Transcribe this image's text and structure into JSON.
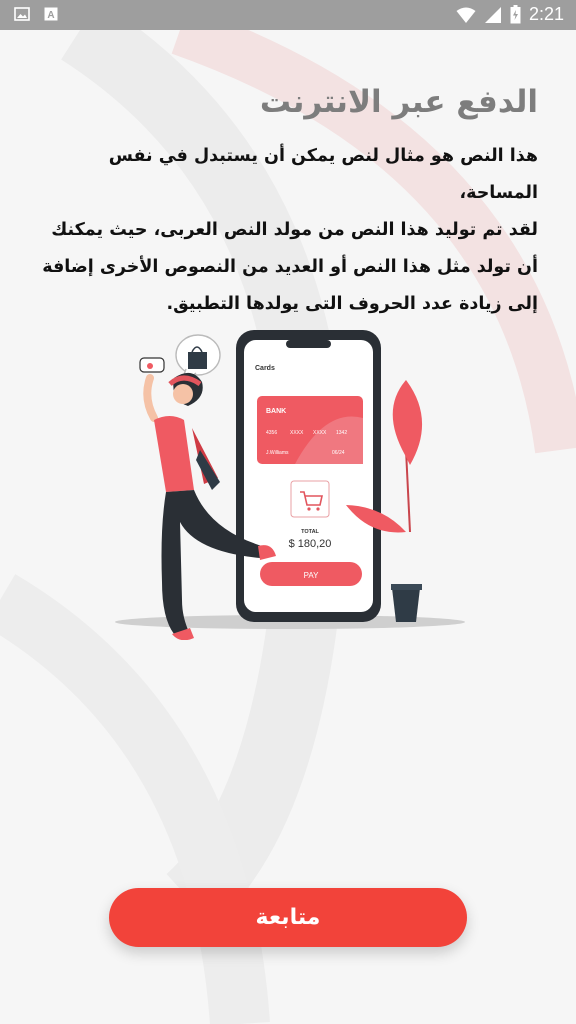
{
  "status_bar": {
    "time": "2:21",
    "left_icons": [
      "image-icon",
      "a-badge-icon"
    ],
    "right_icons": [
      "wifi-icon",
      "signal-icon",
      "battery-icon"
    ]
  },
  "onboarding": {
    "title": "الدفع عبر الانترنت",
    "description_lines": [
      "هذا النص هو مثال لنص يمكن أن يستبدل في نفس المساحة،",
      "لقد تم توليد هذا النص من مولد النص العربى، حيث يمكنك",
      "أن تولد مثل هذا النص أو العديد من النصوص الأخرى إضافة",
      "إلى زيادة عدد الحروف التى يولدها التطبيق."
    ],
    "illustration": {
      "card_header": "Cards",
      "card_bank": "BANK",
      "card_number_parts": [
        "4356",
        "XXXX",
        "XXXX",
        "1342"
      ],
      "card_holder": "J.Williams",
      "card_expiry": "06/24",
      "total_label": "TOTAL",
      "total_amount": "$ 180,20",
      "pay_label": "PAY"
    },
    "continue_button": "متابعة"
  },
  "colors": {
    "accent": "#f2433a",
    "title_gray": "#7d7d7d",
    "status_bar": "#9e9e9e"
  }
}
